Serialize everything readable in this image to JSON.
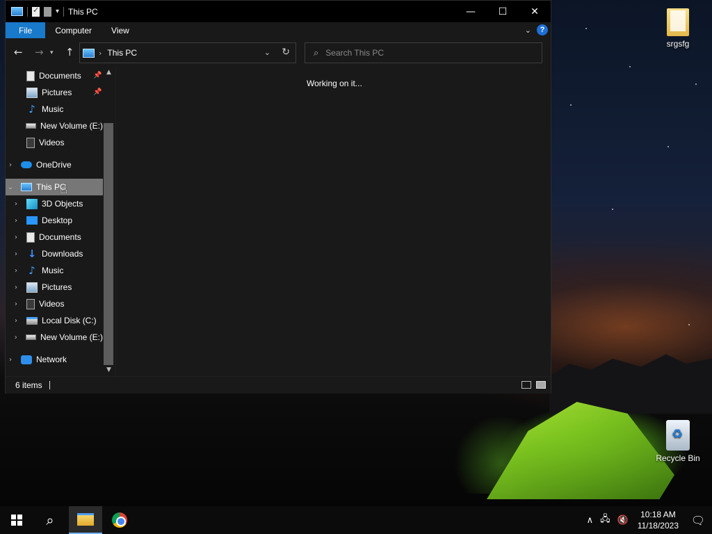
{
  "window": {
    "title": "This PC",
    "controls": {
      "minimize": "—",
      "maximize": "☐",
      "close": "✕"
    }
  },
  "ribbon": {
    "tabs": [
      {
        "label": "File"
      },
      {
        "label": "Computer"
      },
      {
        "label": "View"
      }
    ]
  },
  "address": {
    "path": "This PC"
  },
  "search": {
    "placeholder": "Search This PC"
  },
  "nav": {
    "items": [
      {
        "label": "Documents",
        "icon": "documents-icon",
        "pinned": true
      },
      {
        "label": "Pictures",
        "icon": "pictures-icon",
        "pinned": true
      },
      {
        "label": "Music",
        "icon": "music-icon"
      },
      {
        "label": "New Volume (E:)",
        "icon": "drive-icon"
      },
      {
        "label": "Videos",
        "icon": "videos-icon"
      },
      {
        "label": "OneDrive",
        "icon": "onedrive-icon"
      },
      {
        "label": "This PC",
        "icon": "this-pc-icon",
        "selected": true
      },
      {
        "label": "3D Objects",
        "icon": "3d-objects-icon"
      },
      {
        "label": "Desktop",
        "icon": "desktop-icon"
      },
      {
        "label": "Documents",
        "icon": "documents-icon"
      },
      {
        "label": "Downloads",
        "icon": "downloads-icon"
      },
      {
        "label": "Music",
        "icon": "music-icon"
      },
      {
        "label": "Pictures",
        "icon": "pictures-icon"
      },
      {
        "label": "Videos",
        "icon": "videos-icon"
      },
      {
        "label": "Local Disk (C:)",
        "icon": "local-disk-icon"
      },
      {
        "label": "New Volume (E:)",
        "icon": "drive-icon"
      },
      {
        "label": "Network",
        "icon": "network-icon"
      }
    ]
  },
  "content": {
    "status_message": "Working on it..."
  },
  "statusbar": {
    "item_count": "6 items"
  },
  "desktop": {
    "icons": [
      {
        "label": "srgsfg",
        "icon": "folder-icon"
      },
      {
        "label": "Recycle Bin",
        "icon": "recycle-bin-icon"
      }
    ]
  },
  "taskbar": {
    "time": "10:18 AM",
    "date": "11/18/2023"
  },
  "colors": {
    "accent": "#1979ca",
    "window_bg": "#191919",
    "titlebar_bg": "#000000",
    "selection": "#777777",
    "taskbar_bg": "#0b0b0b"
  }
}
